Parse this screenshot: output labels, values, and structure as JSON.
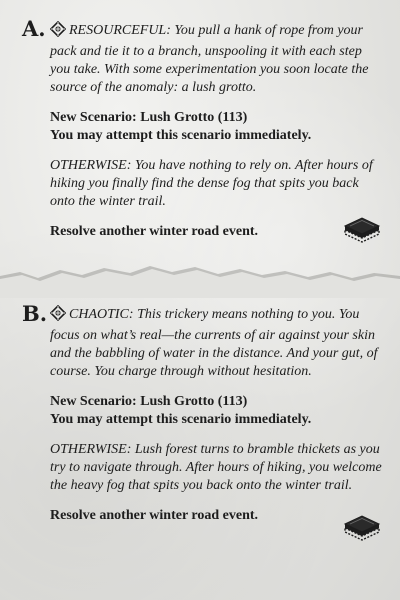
{
  "sections": [
    {
      "letter": "A.",
      "trait": "Resourceful",
      "intro": ": You pull a hank of rope from your pack and tie it to a branch, unspooling it with each step you take. With some experimentation you soon locate the source of the anomaly: a lush grotto.",
      "scenario_line": "New Scenario: Lush Grotto (113)",
      "attempt_line": "You may attempt this scenario immediately.",
      "otherwise_label": "OTHERWISE",
      "otherwise_text": ": You have nothing to rely on. After hours of hiking you finally find the dense fog that spits you back onto the winter trail.",
      "resolve_line": "Resolve another winter road event.",
      "trait_icon": "diamond-knot-icon",
      "deck_icon": "card-deck-icon"
    },
    {
      "letter": "B.",
      "trait": "Chaotic",
      "intro": ": This trickery means nothing to you. You focus on what’s real—the currents of air against your skin and the babbling of water in the distance. And your gut, of course. You charge through without hesitation.",
      "scenario_line": "New Scenario: Lush Grotto (113)",
      "attempt_line": "You may attempt this scenario immediately.",
      "otherwise_label": "OTHERWISE",
      "otherwise_text": ": Lush forest turns to bramble thickets as you try to navigate through. After hours of hiking, you welcome the heavy fog that spits you back onto the winter trail.",
      "resolve_line": "Resolve another winter road event.",
      "trait_icon": "diamond-knot-icon",
      "deck_icon": "card-deck-icon"
    }
  ],
  "colors": {
    "paper": "#e6e6e4",
    "ink": "#1d1d1d",
    "tear_shadow": "#9a9a98"
  }
}
